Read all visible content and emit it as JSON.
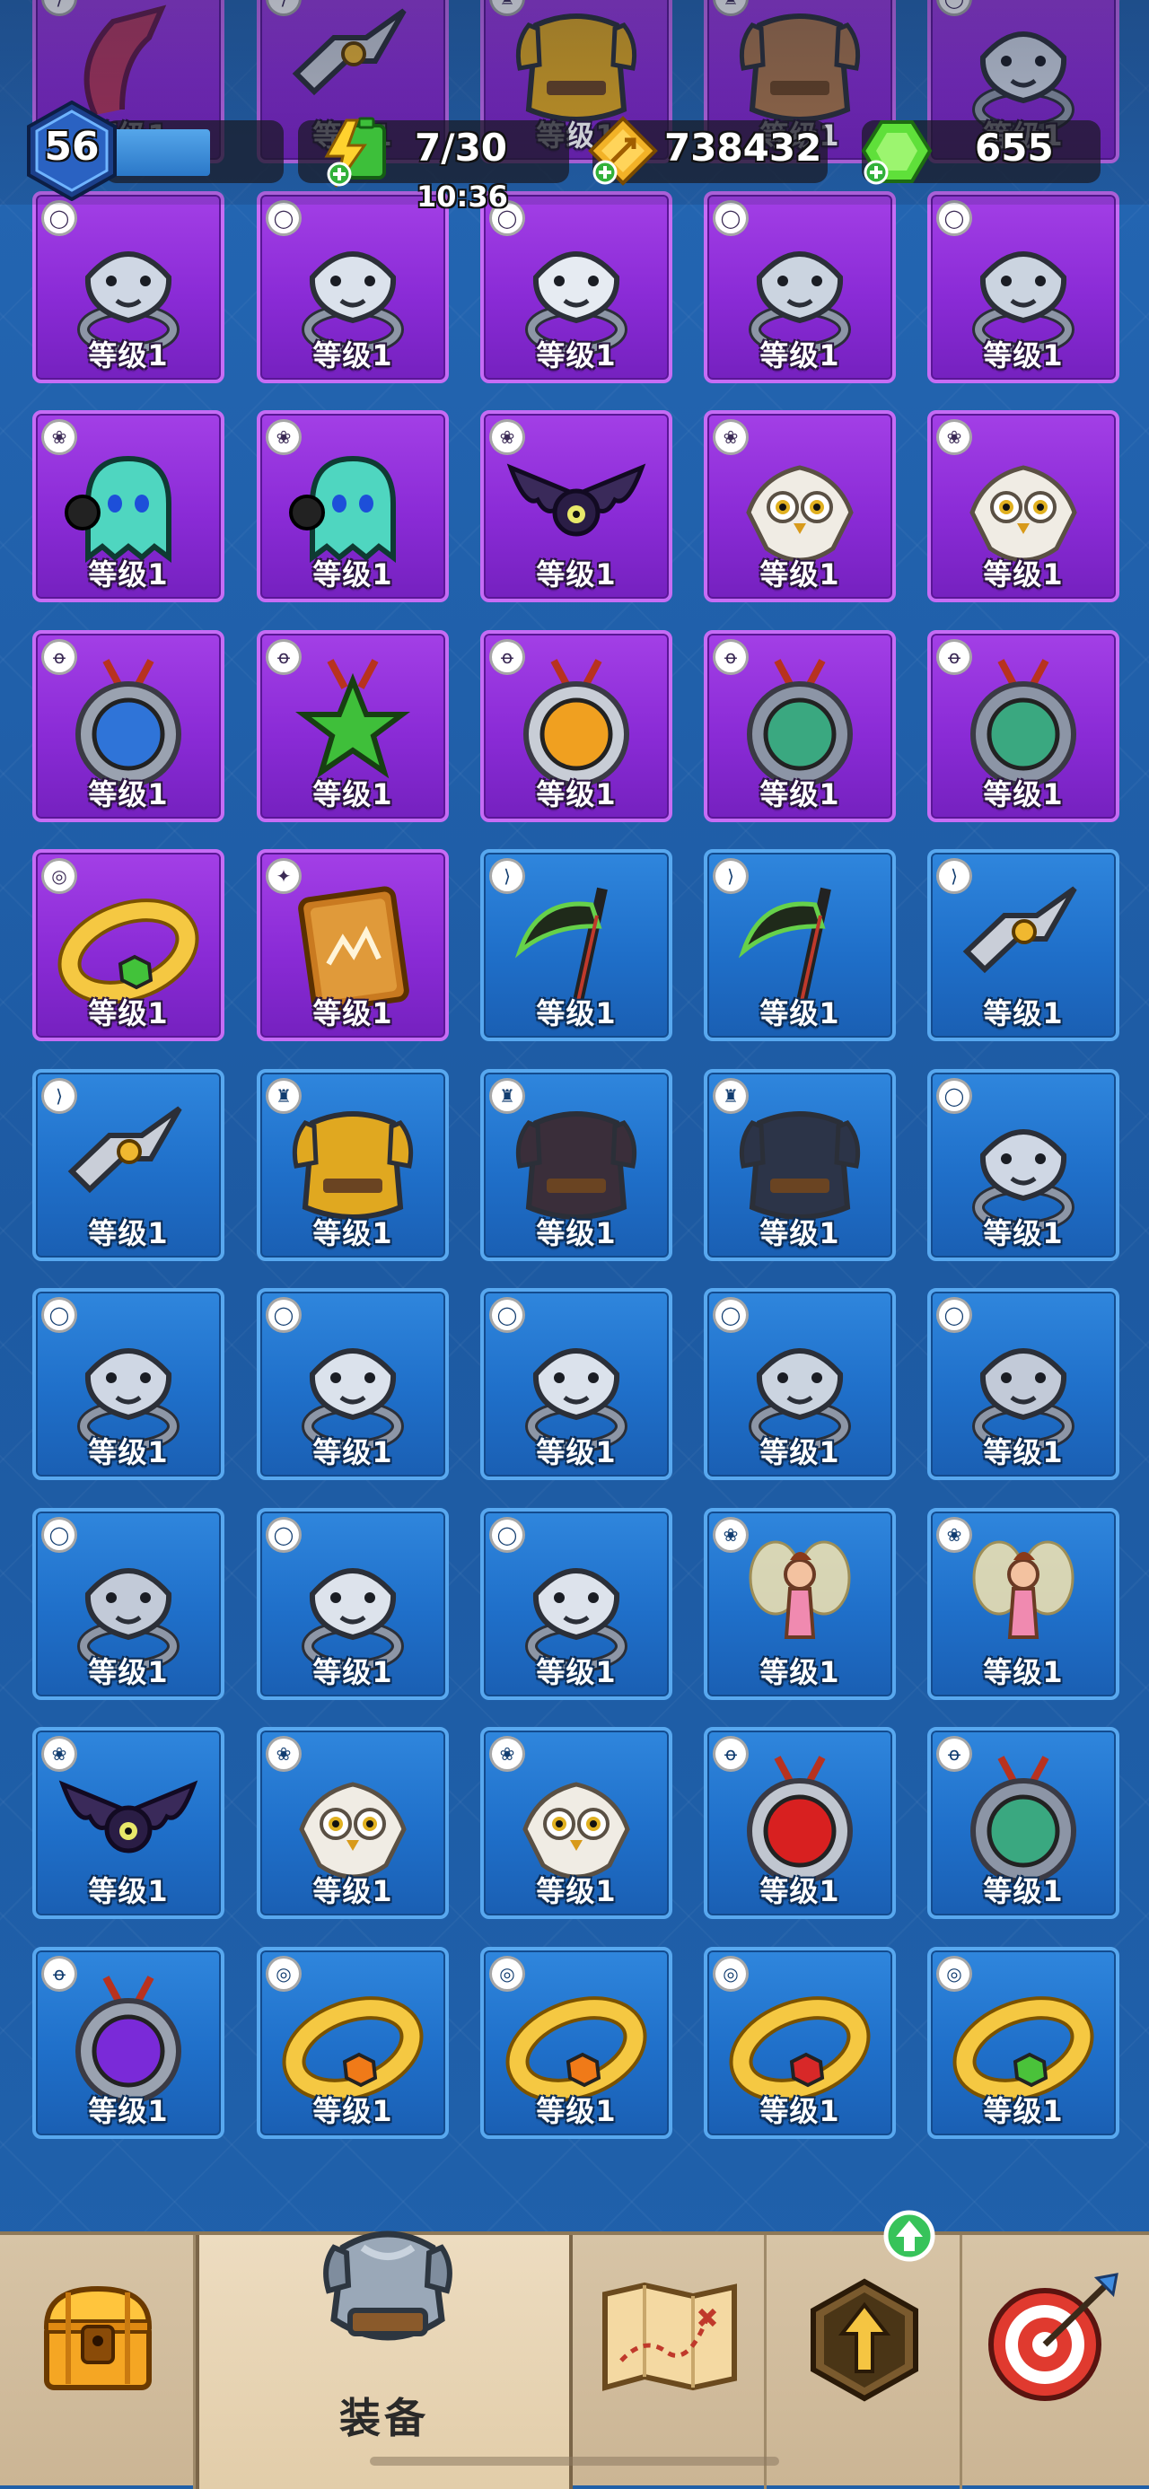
{
  "hud": {
    "player_level": "56",
    "energy": "7/30",
    "energy_timer": "10:36",
    "gold": "738432",
    "gems": "655"
  },
  "item_level_label": "等级1",
  "grid": [
    {
      "color": "purple",
      "slot": "bow",
      "item": "bow-icon"
    },
    {
      "color": "purple",
      "slot": "bow",
      "item": "boomerang-icon"
    },
    {
      "color": "purple",
      "slot": "armor",
      "item": "gold-armor-icon"
    },
    {
      "color": "purple",
      "slot": "armor",
      "item": "leather-armor-icon"
    },
    {
      "color": "purple",
      "slot": "ring",
      "item": "bear-ring-icon"
    },
    {
      "color": "purple",
      "slot": "ring",
      "item": "bear-ring-icon"
    },
    {
      "color": "purple",
      "slot": "ring",
      "item": "wolf-ring-icon"
    },
    {
      "color": "purple",
      "slot": "ring",
      "item": "falcon-ring-icon"
    },
    {
      "color": "purple",
      "slot": "ring",
      "item": "serpent-ring-icon"
    },
    {
      "color": "purple",
      "slot": "ring",
      "item": "serpent-ring-icon"
    },
    {
      "color": "purple",
      "slot": "pet",
      "item": "ghost-pet-icon"
    },
    {
      "color": "purple",
      "slot": "pet",
      "item": "ghost-pet-icon"
    },
    {
      "color": "purple",
      "slot": "pet",
      "item": "bat-pet-icon"
    },
    {
      "color": "purple",
      "slot": "pet",
      "item": "owl-pet-icon"
    },
    {
      "color": "purple",
      "slot": "pet",
      "item": "owl-pet-icon"
    },
    {
      "color": "purple",
      "slot": "amulet",
      "item": "eagle-amulet-icon"
    },
    {
      "color": "purple",
      "slot": "amulet",
      "item": "star-amulet-icon"
    },
    {
      "color": "purple",
      "slot": "amulet",
      "item": "lion-amulet-icon"
    },
    {
      "color": "purple",
      "slot": "amulet",
      "item": "ape-amulet-icon"
    },
    {
      "color": "purple",
      "slot": "amulet",
      "item": "ape-amulet-icon"
    },
    {
      "color": "purple",
      "slot": "bracelet",
      "item": "gold-bracelet-icon"
    },
    {
      "color": "purple",
      "slot": "book",
      "item": "spellbook-icon"
    },
    {
      "color": "blue",
      "slot": "bow",
      "item": "scythe-icon"
    },
    {
      "color": "blue",
      "slot": "bow",
      "item": "scythe-icon"
    },
    {
      "color": "blue",
      "slot": "bow",
      "item": "boomerang-icon"
    },
    {
      "color": "blue",
      "slot": "bow",
      "item": "boomerang-icon"
    },
    {
      "color": "blue",
      "slot": "armor",
      "item": "gold-armor-icon"
    },
    {
      "color": "blue",
      "slot": "armor",
      "item": "dark-vest-icon"
    },
    {
      "color": "blue",
      "slot": "armor",
      "item": "dark-cloak-icon"
    },
    {
      "color": "blue",
      "slot": "ring",
      "item": "bear-ring-icon"
    },
    {
      "color": "blue",
      "slot": "ring",
      "item": "bear-ring-icon"
    },
    {
      "color": "blue",
      "slot": "ring",
      "item": "wolf-ring-icon"
    },
    {
      "color": "blue",
      "slot": "ring",
      "item": "wolf-ring-icon"
    },
    {
      "color": "blue",
      "slot": "ring",
      "item": "serpent-ring-icon"
    },
    {
      "color": "blue",
      "slot": "ring",
      "item": "bull-ring-icon"
    },
    {
      "color": "blue",
      "slot": "ring",
      "item": "bull-ring-icon"
    },
    {
      "color": "blue",
      "slot": "ring",
      "item": "lion-ring-icon"
    },
    {
      "color": "blue",
      "slot": "ring",
      "item": "lion-ring-icon"
    },
    {
      "color": "blue",
      "slot": "pet",
      "item": "fairy-pet-icon"
    },
    {
      "color": "blue",
      "slot": "pet",
      "item": "fairy-pet-icon"
    },
    {
      "color": "blue",
      "slot": "pet",
      "item": "bat-pet-icon"
    },
    {
      "color": "blue",
      "slot": "pet",
      "item": "owl-pet-icon"
    },
    {
      "color": "blue",
      "slot": "pet",
      "item": "owl-pet-icon"
    },
    {
      "color": "blue",
      "slot": "amulet",
      "item": "dragon-amulet-icon"
    },
    {
      "color": "blue",
      "slot": "amulet",
      "item": "ape-amulet-icon"
    },
    {
      "color": "blue",
      "slot": "amulet",
      "item": "bat-amulet-icon"
    },
    {
      "color": "blue",
      "slot": "bracelet",
      "item": "fire-bracelet-icon"
    },
    {
      "color": "blue",
      "slot": "bracelet",
      "item": "fire-bracelet-icon"
    },
    {
      "color": "blue",
      "slot": "bracelet",
      "item": "red-bracelet-icon"
    },
    {
      "color": "blue",
      "slot": "bracelet",
      "item": "green-bracelet-icon"
    }
  ],
  "nav": {
    "items": [
      {
        "name": "treasure-chest-icon"
      },
      {
        "name": "armor-icon",
        "label": "装备"
      },
      {
        "name": "map-icon"
      },
      {
        "name": "upgrade-icon"
      },
      {
        "name": "target-icon"
      }
    ]
  },
  "colors": {
    "purple_tile": "#8a2bd6",
    "blue_tile": "#1f6fc9",
    "nav_bg": "#d7c4a6"
  }
}
